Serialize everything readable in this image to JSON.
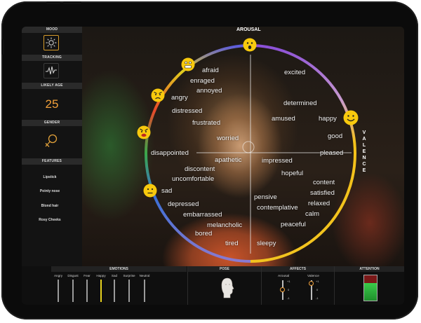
{
  "sidebar": {
    "mood": {
      "title": "MOOD",
      "icon": "sun-icon"
    },
    "tracking": {
      "title": "TRACKING",
      "icon": "waveform-icon"
    },
    "age": {
      "title": "LIKELY AGE",
      "value": "25"
    },
    "gender": {
      "title": "GENDER",
      "icon": "female-symbol-icon"
    },
    "features": {
      "title": "FEATURES",
      "items": [
        "Lipstick",
        "Pointy nose",
        "Blond hair",
        "Rosy Cheeks"
      ]
    }
  },
  "wheel": {
    "arousal_label": "AROUSAL",
    "valence_label": "VALENCE",
    "emotions": {
      "afraid": "afraid",
      "enraged": "enraged",
      "annoyed": "annoyed",
      "angry": "angry",
      "distressed": "distressed",
      "frustrated": "frustrated",
      "worried": "worried",
      "disappointed": "disappointed",
      "apathetic": "apathetic",
      "discontent": "discontent",
      "uncomfortable": "uncomfortable",
      "sad": "sad",
      "depressed": "depressed",
      "embarrassed": "embarrassed",
      "melancholic": "melancholic",
      "bored": "bored",
      "tired": "tired",
      "sleepy": "sleepy",
      "excited": "excited",
      "determined": "determined",
      "amused": "amused",
      "happy": "happy",
      "good": "good",
      "pleased": "pleased",
      "impressed": "impressed",
      "hopeful": "hopeful",
      "content": "content",
      "satisfied": "satisfied",
      "pensive": "pensive",
      "relaxed": "relaxed",
      "contemplative": "contemplative",
      "calm": "calm",
      "peaceful": "peaceful"
    },
    "colors": {
      "purple": "#8a4fd6",
      "yellow": "#f4c21a",
      "red": "#e23a2a",
      "green": "#3aa84a",
      "blue": "#3a6fd6"
    }
  },
  "bottom": {
    "emotions": {
      "title": "EMOTIONS",
      "items": [
        {
          "label": "Angry",
          "active": false
        },
        {
          "label": "Disgust",
          "active": false
        },
        {
          "label": "Fear",
          "active": false
        },
        {
          "label": "Happy",
          "active": true
        },
        {
          "label": "Sad",
          "active": false
        },
        {
          "label": "Surprise",
          "active": false
        },
        {
          "label": "Neutral",
          "active": false
        }
      ]
    },
    "pose": {
      "title": "POSE",
      "icon": "head-pose-icon"
    },
    "affects": {
      "title": "AFFECTS",
      "arousal": {
        "label": "Arousal",
        "ticks": [
          "+1",
          "0",
          "-1"
        ]
      },
      "valence": {
        "label": "Valence",
        "ticks": [
          "+1",
          "0",
          "-1"
        ]
      }
    },
    "attention": {
      "title": "ATTENTION",
      "level": 0.7
    }
  }
}
